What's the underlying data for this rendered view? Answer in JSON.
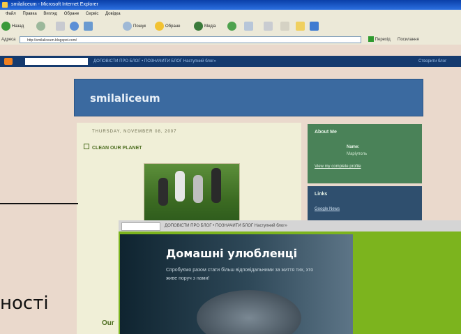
{
  "browser": {
    "title": "smilaliceum - Microsoft Internet Explorer",
    "menu": [
      "Файл",
      "Правка",
      "Вигляд",
      "Обране",
      "Сервіс",
      "Довідка"
    ],
    "toolbar": {
      "back": "Назад",
      "search": "Пошук",
      "favorites": "Обране",
      "media": "Медіа"
    },
    "address_label": "Адреса",
    "address": "http://smilaliceum.blogspot.com/",
    "go": "Перехід",
    "links": "Посилання"
  },
  "blogger_nav": {
    "links": "ДОПОВІСТИ ПРО БЛОГ  •  ПОЗНАЧИТИ БЛОГ  Наступний блог»",
    "create": "Створити блог"
  },
  "blog": {
    "title": "smilaliceum",
    "date": "THURSDAY, NOVEMBER 08, 2007",
    "post_title": "CLEAN OUR PLANET",
    "footer_fragment": "Our"
  },
  "sidebar": {
    "about_title": "About Me",
    "name_label": "Name:",
    "name_value": "Маріуполь",
    "profile_link": "View my complete profile",
    "links_title": "Links",
    "link_item": "Google News"
  },
  "overlay": {
    "nav_text": "ДОПОВІСТИ ПРО БЛОГ  •  ПОЗНАЧИТИ БЛОГ  Наступний блог»",
    "title": "Домашні улюбленці",
    "description": "Спробуємо разом стати більш відповідальними за життя тих, хто живе поруч з нами!"
  },
  "slide": {
    "text": "ності"
  }
}
